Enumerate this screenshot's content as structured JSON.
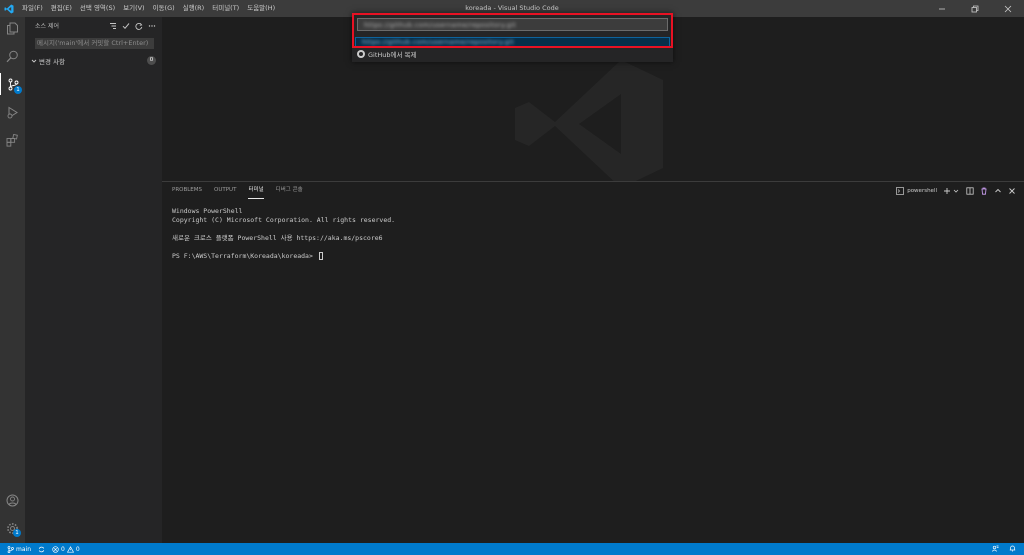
{
  "window": {
    "title": "koreada - Visual Studio Code"
  },
  "menu": {
    "items": [
      "파일(F)",
      "편집(E)",
      "선택 영역(S)",
      "보기(V)",
      "이동(G)",
      "실행(R)",
      "터미널(T)",
      "도움말(H)"
    ]
  },
  "activity_bar": {
    "scm_badge": "1",
    "manage_badge": "1"
  },
  "sidebar": {
    "title": "소스 제어",
    "commit_placeholder": "메시지('main'에서 커밋할 Ctrl+Enter)",
    "changes_label": "변경 사항",
    "changes_count": "0"
  },
  "quick_pick": {
    "input_value": "https://github.com/username/repository.git",
    "selected_item": "https://github.com/username/repository.git",
    "github_clone_label": "GitHub에서 복제"
  },
  "panel": {
    "tabs": [
      "PROBLEMS",
      "OUTPUT",
      "터미널",
      "디버그 콘솔"
    ],
    "active_tab_index": 2,
    "terminal_name": "powershell"
  },
  "terminal": {
    "lines": [
      "Windows PowerShell",
      "Copyright (C) Microsoft Corporation. All rights reserved.",
      "",
      "새로운 크로스 플랫폼 PowerShell 사용 https://aka.ms/pscore6",
      ""
    ],
    "prompt": "PS F:\\AWS\\Terraform\\Koreada\\koreada> "
  },
  "status_bar": {
    "branch": "main",
    "errors": "0",
    "warnings": "0"
  },
  "colors": {
    "accent": "#007acc",
    "highlight_border": "#e81123"
  }
}
